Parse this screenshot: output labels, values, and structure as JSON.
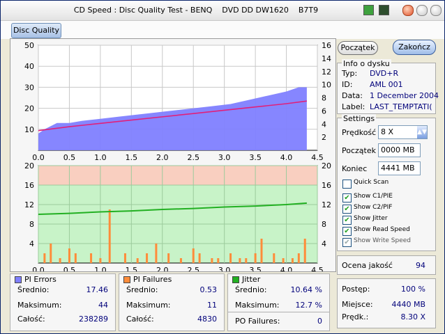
{
  "window": {
    "title": "CD Speed : Disc Quality Test - BENQ    DVD DD DW1620    B7T9"
  },
  "tabs": [
    {
      "label": "Disc Quality"
    }
  ],
  "buttons": {
    "start": "Początek",
    "stop": "Zakończ"
  },
  "disc_info": {
    "title": "Info o dysku",
    "rows": [
      {
        "label": "Typ:",
        "value": "DVD+R"
      },
      {
        "label": "ID:",
        "value": "AML 001"
      },
      {
        "label": "Data:",
        "value": "1 December 2004"
      },
      {
        "label": "Label:",
        "value": "LAST_TEMPTATI("
      }
    ]
  },
  "settings": {
    "title": "Settings",
    "speed_label": "Prędkość",
    "speed_value": "8 X",
    "start_label": "Początek",
    "start_value": "0000 MB",
    "end_label": "Koniec",
    "end_value": "4441 MB",
    "checkboxes": [
      {
        "label": "Quick Scan",
        "checked": false
      },
      {
        "label": "Show C1/PIE",
        "checked": true
      },
      {
        "label": "Show C2/PIF",
        "checked": true
      },
      {
        "label": "Show Jitter",
        "checked": true
      },
      {
        "label": "Show Read Speed",
        "checked": true
      },
      {
        "label": "Show Write Speed",
        "checked": true
      }
    ]
  },
  "quality": {
    "label": "Ocena jakość",
    "value": "94"
  },
  "progress": {
    "rows": [
      {
        "label": "Postęp:",
        "value": "100 %"
      },
      {
        "label": "Miejsce:",
        "value": "4440 MB"
      },
      {
        "label": "Prędk.:",
        "value": "8.30 X"
      }
    ]
  },
  "stats": {
    "pi_errors": {
      "title": "PI Errors",
      "color": "#7f7fff",
      "rows": [
        {
          "label": "Średnio:",
          "value": "17.46"
        },
        {
          "label": "Maksimum:",
          "value": "44"
        },
        {
          "label": "Całość:",
          "value": "238289"
        }
      ]
    },
    "pi_failures": {
      "title": "PI Failures",
      "color": "#ff8c3a",
      "rows": [
        {
          "label": "Średnio:",
          "value": "0.53"
        },
        {
          "label": "Maksimum:",
          "value": "11"
        },
        {
          "label": "Całość:",
          "value": "4830"
        }
      ]
    },
    "jitter": {
      "title": "Jitter",
      "color": "#22b022",
      "rows": [
        {
          "label": "Średnio:",
          "value": "10.64 %"
        },
        {
          "label": "Maksimum:",
          "value": "12.7 %"
        }
      ],
      "po_label": "PO Failures:",
      "po_value": "0"
    }
  },
  "chart_data": [
    {
      "type": "area",
      "title": "",
      "x_ticks": [
        "0.0",
        "0.5",
        "1.0",
        "1.5",
        "2.0",
        "2.5",
        "3.0",
        "3.5",
        "4.0",
        "4.5"
      ],
      "y_left_ticks": [
        "10",
        "20",
        "30",
        "40",
        "50"
      ],
      "y_right_ticks": [
        "2",
        "4",
        "6",
        "8",
        "10",
        "12",
        "14",
        "16"
      ],
      "xlim": [
        0,
        4.5
      ],
      "ylim": [
        0,
        50
      ],
      "y_right_lim": [
        0,
        16
      ],
      "series": [
        {
          "name": "PI Errors",
          "color": "#7f7fff",
          "x": [
            0.0,
            0.1,
            0.3,
            0.5,
            0.7,
            1.0,
            1.3,
            1.6,
            1.9,
            2.2,
            2.5,
            2.8,
            3.1,
            3.4,
            3.7,
            4.0,
            4.2,
            4.33
          ],
          "values": [
            8,
            10,
            13,
            13,
            14,
            15,
            16,
            17,
            18,
            19,
            20,
            21,
            22,
            24,
            26,
            28,
            30,
            30
          ]
        },
        {
          "name": "Read Speed",
          "color": "#e0207a",
          "x": [
            0.0,
            0.5,
            1.0,
            1.5,
            2.0,
            2.5,
            3.0,
            3.5,
            4.0,
            4.33
          ],
          "values": [
            3.0,
            3.6,
            4.1,
            4.6,
            5.1,
            5.6,
            6.1,
            6.6,
            7.1,
            7.5
          ]
        }
      ],
      "grid": true
    },
    {
      "type": "area",
      "title": "",
      "x_ticks": [
        "0.0",
        "0.5",
        "1.0",
        "1.5",
        "2.0",
        "2.5",
        "3.0",
        "3.5",
        "4.0",
        "4.5"
      ],
      "y_left_ticks": [
        "4",
        "8",
        "12",
        "16",
        "20"
      ],
      "y_right_ticks": [
        "4",
        "8",
        "12",
        "16",
        "20"
      ],
      "xlim": [
        0,
        4.5
      ],
      "ylim": [
        0,
        20
      ],
      "series": [
        {
          "name": "PI Failures",
          "color": "#ff8c3a",
          "x": [
            0.1,
            0.2,
            0.35,
            0.5,
            0.6,
            0.85,
            1.0,
            1.15,
            1.4,
            1.6,
            1.75,
            1.9,
            2.1,
            2.3,
            2.5,
            2.6,
            2.8,
            2.9,
            3.1,
            3.25,
            3.35,
            3.5,
            3.6,
            3.8,
            3.95,
            4.1,
            4.2,
            4.3
          ],
          "values": [
            2,
            4,
            1,
            3,
            2,
            2,
            1,
            11,
            2,
            1,
            2,
            4,
            2,
            1,
            3,
            2,
            1,
            1,
            2,
            1,
            1,
            2,
            5,
            2,
            1,
            1,
            2,
            5
          ]
        },
        {
          "name": "Jitter",
          "color": "#22b022",
          "x": [
            0.0,
            0.5,
            1.0,
            1.5,
            2.0,
            2.5,
            3.0,
            3.5,
            4.0,
            4.33
          ],
          "values": [
            10,
            10.2,
            10.5,
            10.7,
            11,
            11.2,
            11.5,
            11.7,
            12,
            12.3
          ]
        }
      ],
      "grid": true
    }
  ]
}
